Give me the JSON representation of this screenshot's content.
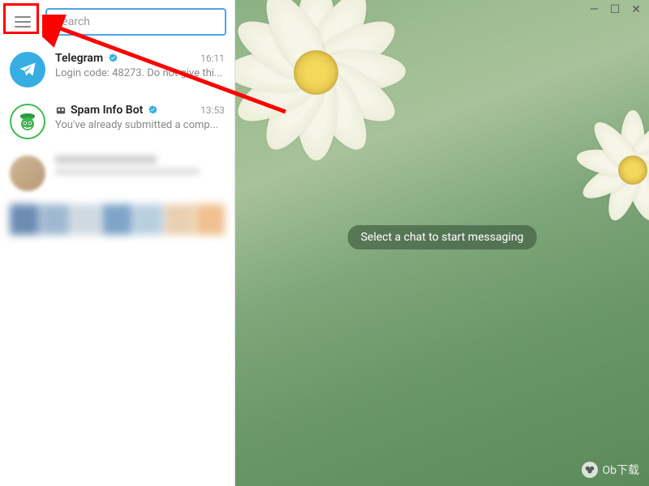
{
  "window": {
    "minimize": "—",
    "maximize": "☐",
    "close": "✕"
  },
  "sidebar": {
    "search_placeholder": "Search",
    "chats": [
      {
        "title": "Telegram",
        "verified": true,
        "time": "16:11",
        "preview": "Login code: 48273. Do not give thi..."
      },
      {
        "title": "Spam Info Bot",
        "verified": true,
        "has_bot_icon": true,
        "time": "13:53",
        "preview": "You've already submitted a comp..."
      }
    ]
  },
  "main": {
    "empty_message": "Select a chat to start messaging"
  },
  "watermark": {
    "text": "Ob下载"
  }
}
